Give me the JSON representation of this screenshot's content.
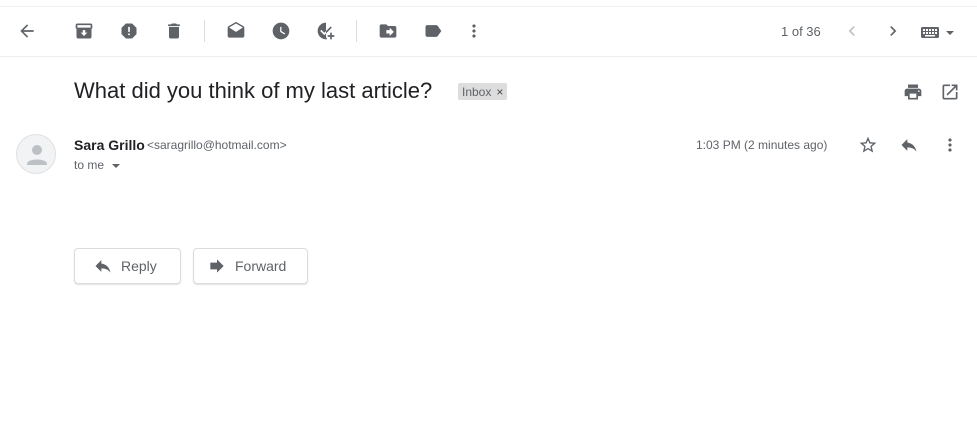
{
  "toolbar": {
    "icons": [
      "back-arrow-icon",
      "archive-icon",
      "report-spam-icon",
      "delete-icon",
      "mark-unread-icon",
      "snooze-icon",
      "add-to-tasks-icon",
      "move-to-icon",
      "labels-icon",
      "more-vert-icon"
    ],
    "pager": "1 of 36"
  },
  "message": {
    "subject": "What did you think of my last article?",
    "label": "Inbox",
    "label_remove": "×",
    "sender_name": "Sara Grillo",
    "sender_email": "<saragrillo@hotmail.com>",
    "recipient": "to me",
    "timestamp": "1:03 PM (2 minutes ago)"
  },
  "actions": {
    "reply_label": "Reply",
    "forward_label": "Forward"
  },
  "colors": {
    "icon": "#5f6368",
    "text": "#202124",
    "chip_bg": "#dddddd",
    "border": "#dadce0"
  }
}
